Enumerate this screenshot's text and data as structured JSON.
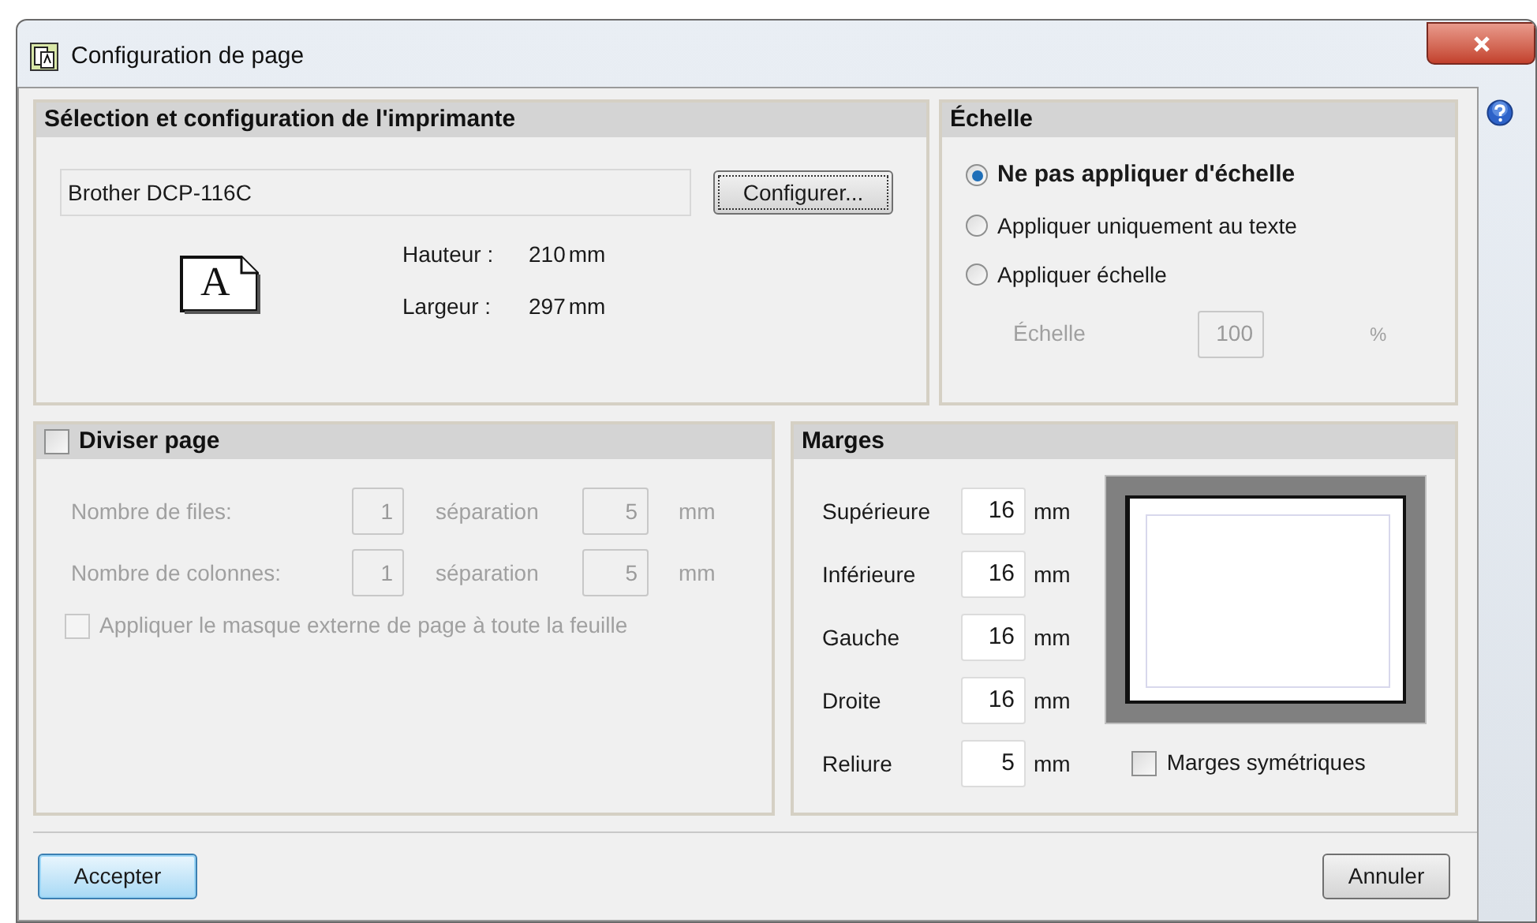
{
  "window": {
    "title": "Configuration de page"
  },
  "printer_panel": {
    "title": "Sélection et configuration de l'imprimante",
    "paper_letter": "A",
    "printer": "Brother DCP-116C",
    "configure_button": "Configurer...",
    "height_label": "Hauteur :",
    "height_value": "210",
    "height_unit": "mm",
    "width_label": "Largeur :",
    "width_value": "297",
    "width_unit": "mm"
  },
  "scale_panel": {
    "title": "Échelle",
    "options": [
      {
        "label": "Ne pas appliquer d'échelle",
        "selected": true
      },
      {
        "label": "Appliquer uniquement au texte",
        "selected": false
      },
      {
        "label": "Appliquer échelle",
        "selected": false
      }
    ],
    "scale": {
      "label": "Échelle",
      "value": "100",
      "unit": "%",
      "disabled": true
    }
  },
  "divide_panel": {
    "title": "Diviser page",
    "checked": false,
    "rows": [
      {
        "label": "Nombre de files:",
        "value": "1",
        "separation_label": "séparation",
        "separation_value": "5",
        "unit": "mm",
        "disabled": true
      },
      {
        "label": "Nombre de colonnes:",
        "value": "1",
        "separation_label": "séparation",
        "separation_value": "5",
        "unit": "mm",
        "disabled": true
      }
    ],
    "mask_option": {
      "label": "Appliquer le masque externe de page à toute la feuille",
      "checked": false,
      "disabled": true
    }
  },
  "margins_panel": {
    "title": "Marges",
    "fields": [
      {
        "label": "Supérieure",
        "value": "16",
        "unit": "mm"
      },
      {
        "label": "Inférieure",
        "value": "16",
        "unit": "mm"
      },
      {
        "label": "Gauche",
        "value": "16",
        "unit": "mm"
      },
      {
        "label": "Droite",
        "value": "16",
        "unit": "mm"
      },
      {
        "label": "Reliure",
        "value": "5",
        "unit": "mm"
      }
    ],
    "symmetric": {
      "label": "Marges symétriques",
      "checked": false
    }
  },
  "buttons": [
    {
      "label": "Accepter",
      "default": true
    },
    {
      "label": "Annuler",
      "default": false
    }
  ]
}
